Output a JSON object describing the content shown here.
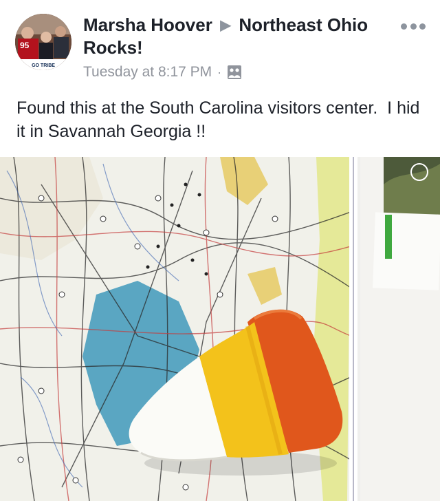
{
  "post": {
    "author": "Marsha Hoover",
    "arrow_icon": "right-triangle-icon",
    "group": "Northeast Ohio Rocks!",
    "timestamp": "Tuesday at 8:17 PM",
    "separator": "·",
    "audience_icon": "group-audience-icon",
    "more_icon": "more-horizontal-icon",
    "text": "Found this at the South Carolina visitors center.  I hid it in Savannah Georgia !!"
  },
  "avatar": {
    "jersey_text": "95",
    "banner_text": "GO TRIBE"
  },
  "colors": {
    "name_text": "#1d2129",
    "meta_text": "#90949c",
    "map_water": "#5aa6c2",
    "candy_orange": "#e0571c",
    "candy_yellow": "#f3c21b",
    "candy_white": "#fbfbf7"
  }
}
